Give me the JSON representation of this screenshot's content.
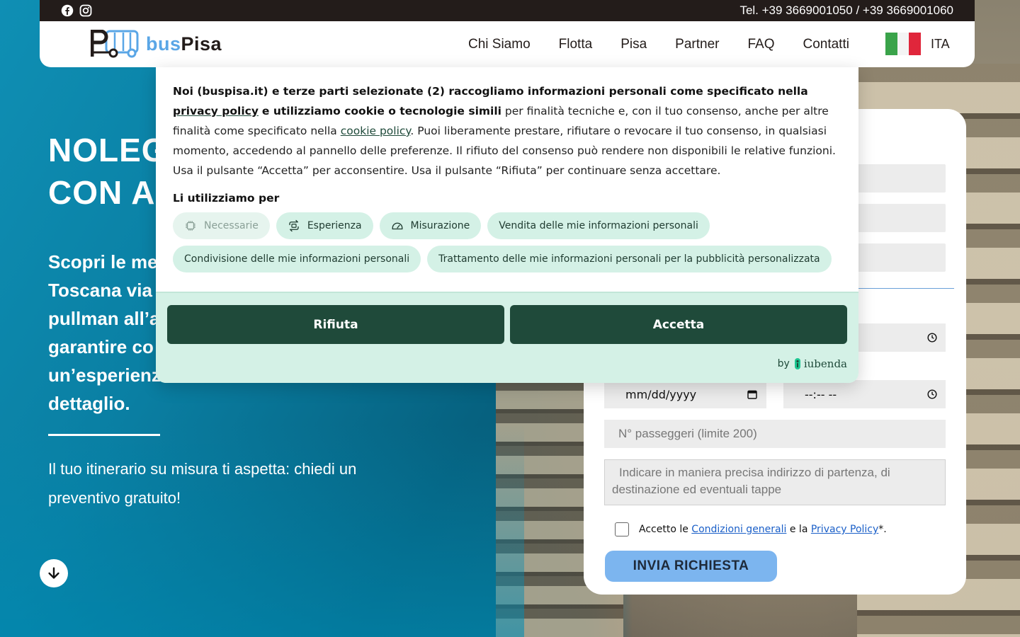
{
  "topbar": {
    "phone": "Tel. +39 3669001050 / +39 3669001060",
    "icons": [
      "facebook-icon",
      "instagram-icon"
    ]
  },
  "header": {
    "logo": {
      "part1": "bus",
      "part2": "Pisa"
    },
    "nav": [
      "Chi Siamo",
      "Flotta",
      "Pisa",
      "Partner",
      "FAQ",
      "Contatti"
    ],
    "language": "ITA"
  },
  "hero": {
    "title_line1": "NOLEG",
    "title_line2": "CON AU",
    "subtitle": "Scopri le me\nToscana via\npullman all’a\ngarantire co\nun’esperienz\ndettaglio.",
    "cta_text": "Il tuo itinerario su misura ti aspetta: chiedi un preventivo gratuito!"
  },
  "form": {
    "date_placeholder": "mm/dd/yyyy",
    "time_placeholder": "--:-- --",
    "passengers_placeholder": "N° passeggeri (limite 200)",
    "route_placeholder": "Indicare in maniera precisa indirizzo di partenza, di destinazione ed eventuali tappe",
    "consent_prefix": "Accetto le",
    "consent_terms_link": "Condizioni generali",
    "consent_middle": "e la",
    "consent_privacy_link": "Privacy Policy",
    "consent_suffix": "*.",
    "submit_label": "INVIA RICHIESTA"
  },
  "cookie": {
    "text_bold1": "Noi (buspisa.it) e terze parti selezionate (2) raccogliamo informazioni personali come specificato nella",
    "privacy_link": "privacy policy",
    "text_bold2": "e utilizziamo cookie o tecnologie simili",
    "text_normal1": "per finalità tecniche e, con il tuo consenso, anche per altre finalità come specificato nella",
    "cookie_link": "cookie policy",
    "text_normal2": ". Puoi liberamente prestare, rifiutare o revocare il tuo consenso, in qualsiasi momento, accedendo al pannello delle preferenze. Il rifiuto del consenso può rendere non disponibili le relative funzioni. Usa il pulsante “Accetta” per acconsentire. Usa il pulsante “Rifiuta” per continuare senza accettare.",
    "purposes_title": "Li utilizziamo per",
    "chips": [
      {
        "label": "Necessarie",
        "icon": "chip-icon"
      },
      {
        "label": "Esperienza",
        "icon": "sync-icon"
      },
      {
        "label": "Misurazione",
        "icon": "gauge-icon"
      },
      {
        "label": "Vendita delle mie informazioni personali"
      },
      {
        "label": "Condivisione delle mie informazioni personali"
      },
      {
        "label": "Trattamento delle mie informazioni personali per la pubblicità personalizzata"
      }
    ],
    "reject_label": "Rifiuta",
    "accept_label": "Accetta",
    "powered_by": "by",
    "brand": "iubenda"
  }
}
